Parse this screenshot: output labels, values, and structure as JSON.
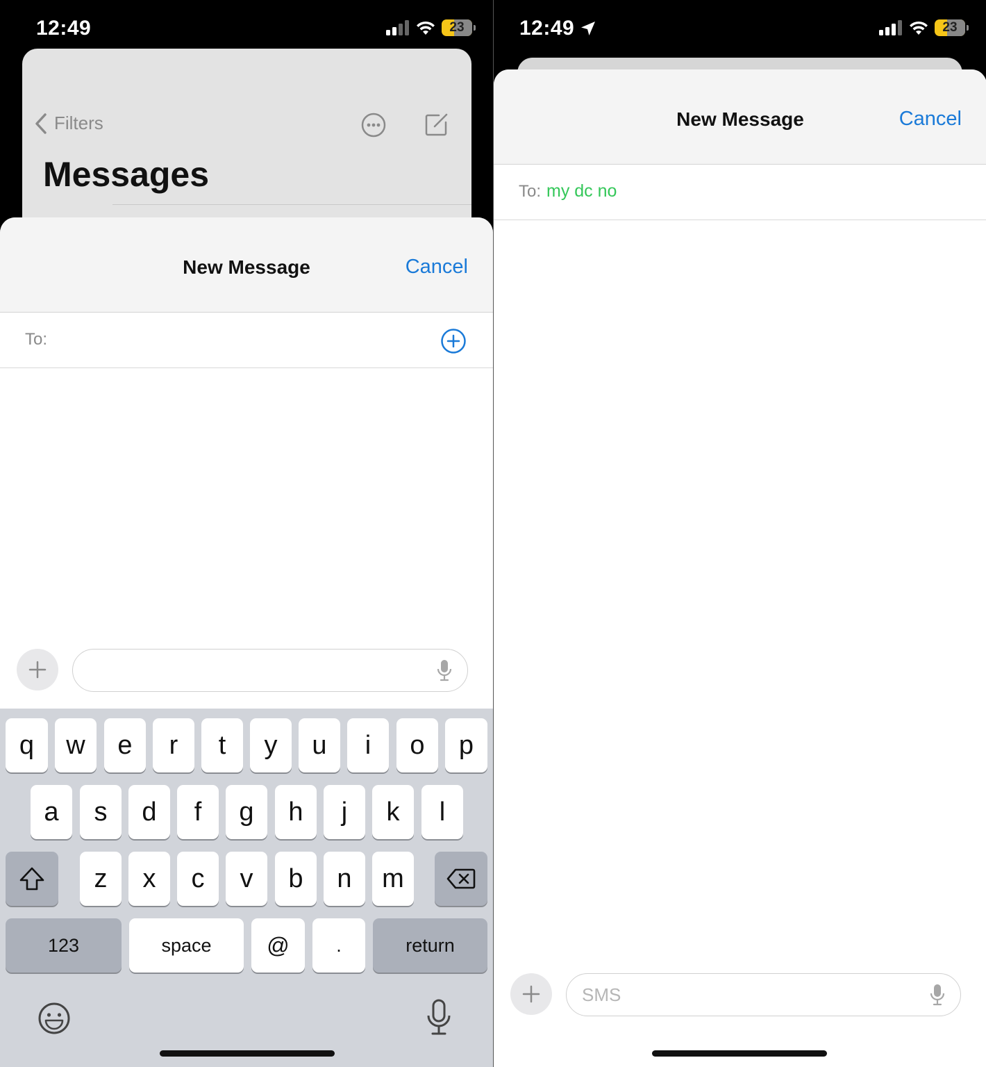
{
  "left": {
    "status": {
      "time": "12:49",
      "battery": "23"
    },
    "background": {
      "back_label": "Filters",
      "title": "Messages"
    },
    "sheet": {
      "title": "New Message",
      "cancel": "Cancel",
      "to_label": "To:"
    },
    "input": {
      "placeholder": ""
    },
    "keyboard": {
      "row1": [
        "q",
        "w",
        "e",
        "r",
        "t",
        "y",
        "u",
        "i",
        "o",
        "p"
      ],
      "row2": [
        "a",
        "s",
        "d",
        "f",
        "g",
        "h",
        "j",
        "k",
        "l"
      ],
      "row3": [
        "z",
        "x",
        "c",
        "v",
        "b",
        "n",
        "m"
      ],
      "numbers_key": "123",
      "space_key": "space",
      "at_key": "@",
      "period_key": ".",
      "return_key": "return"
    }
  },
  "right": {
    "status": {
      "time": "12:49",
      "battery": "23"
    },
    "sheet": {
      "title": "New Message",
      "cancel": "Cancel",
      "to_label": "To:",
      "to_value": "my dc no"
    },
    "input": {
      "placeholder": "SMS"
    }
  },
  "colors": {
    "accent": "#1a7ad8",
    "recipient_green": "#34c759",
    "battery": "#f5c518"
  }
}
